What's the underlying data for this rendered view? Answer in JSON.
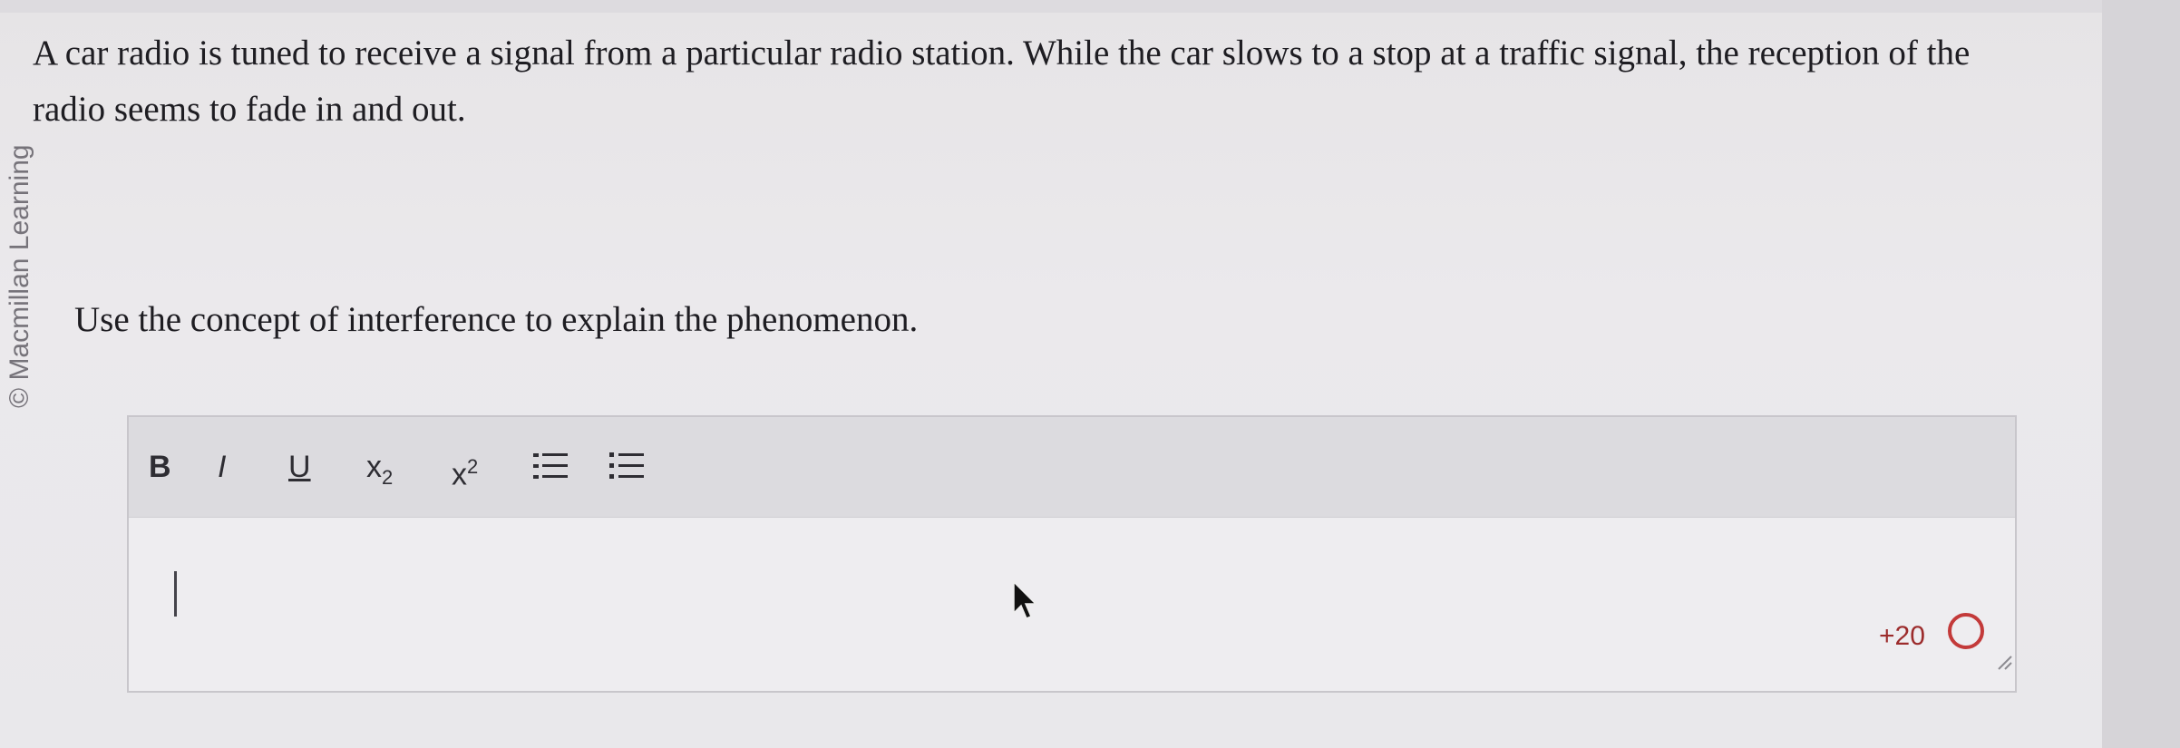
{
  "watermark": "© Macmillan Learning",
  "question": {
    "text": "A car radio is tuned to receive a signal from a particular radio station. While the car slows to a stop at a traffic signal, the reception of the radio seems to fade in and out.",
    "prompt": "Use the concept of interference to explain the phenomenon."
  },
  "editor": {
    "toolbar": {
      "bold_label": "B",
      "italic_label": "I",
      "underline_label": "U",
      "subscript_base": "x",
      "subscript_mark": "2",
      "superscript_base": "x",
      "superscript_mark": "2",
      "ordered_list_icon": "ordered-list-icon",
      "bullet_list_icon": "bullet-list-icon"
    },
    "value": "",
    "score": "+20"
  },
  "colors": {
    "score": "#9c2c2c",
    "ring": "#c33a3a",
    "toolbar_bg": "#dcdbdf"
  }
}
